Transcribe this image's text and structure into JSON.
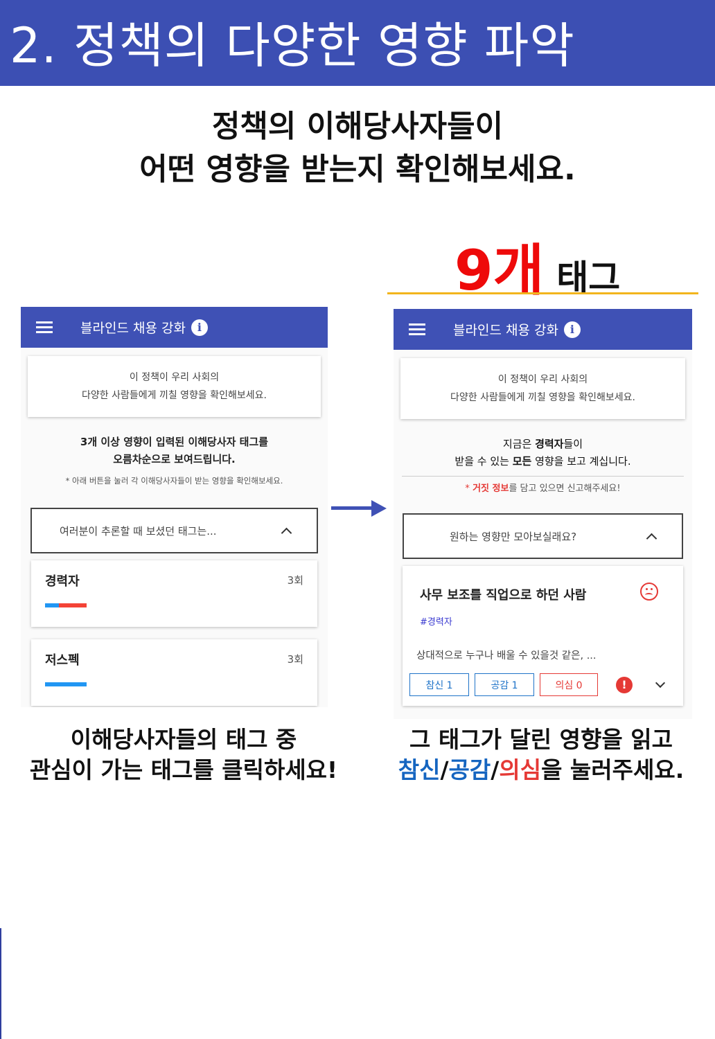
{
  "banner": {
    "title": "2. 정책의 다양한 영향 파악"
  },
  "subtitle": {
    "line1": "정책의 이해당사자들이",
    "line2": "어떤 영향을 받는지 확인해보세요."
  },
  "tag_count": {
    "number": "9개",
    "word": "태그"
  },
  "app_title": "블라인드 채용 강화",
  "left_phone": {
    "intro_line1": "이 정책이 우리 사회의",
    "intro_line2": "다양한 사람들에게 끼칠 영향을 확인해보세요.",
    "info_line1": "3개 이상 영향이 입력된 이해당사자 태그를",
    "info_line2": "오름차순으로 보여드립니다.",
    "hint": "* 아래 버튼을 눌러 각 이해당사자들이 받는 영향을 확인해보세요.",
    "dropdown": "여러분이 추론할 때 보셨던 태그는...",
    "tags": [
      {
        "name": "경력자",
        "count": "3회",
        "bar": [
          {
            "color": "#2196f3",
            "value": 1
          },
          {
            "color": "#f44336",
            "value": 2
          }
        ]
      },
      {
        "name": "저스펙",
        "count": "3회",
        "bar": [
          {
            "color": "#2196f3",
            "value": 3
          }
        ]
      }
    ]
  },
  "right_phone": {
    "intro_line1": "이 정책이 우리 사회의",
    "intro_line2": "다양한 사람들에게 끼칠 영향을 확인해보세요.",
    "status_prefix": "지금은 ",
    "status_tag": "경력자",
    "status_suffix": "들이",
    "status2_prefix": "받을 수 있는 ",
    "status2_bold": "모든",
    "status2_suffix": " 영향을 보고 계십니다.",
    "report_star": "* ",
    "report_red": "거짓 정보",
    "report_rest": "를 담고 있으면 신고해주세요!",
    "dropdown": "원하는 영향만 모아보실래요?",
    "impact": {
      "title": "사무 보조를 직업으로 하던 사람",
      "hashtag": "#경력자",
      "snippet": "상대적으로 누구나 배울 수 있을것 같은, ...",
      "btn_agree": "참신 1",
      "btn_empathy": "공감 1",
      "btn_doubt": "의심 0",
      "alert_symbol": "!"
    }
  },
  "captions": {
    "left_line1": "이해당사자들의 태그 중",
    "left_line2": "관심이 가는 태그를 클릭하세요!",
    "right_line1": "그 태그가 달린 영향을 읽고",
    "right_w1": "참신",
    "right_slash1": "/",
    "right_w2": "공감",
    "right_slash2": "/",
    "right_w3": "의심",
    "right_tail": "을 눌러주세요."
  },
  "colors": {
    "banner": "#3c4fb3",
    "appbar": "#3f51b5",
    "accent_red": "#ee0a0a",
    "underline": "#f2b51c",
    "caption_blue": "#1565c0",
    "caption_red": "#e53935"
  }
}
